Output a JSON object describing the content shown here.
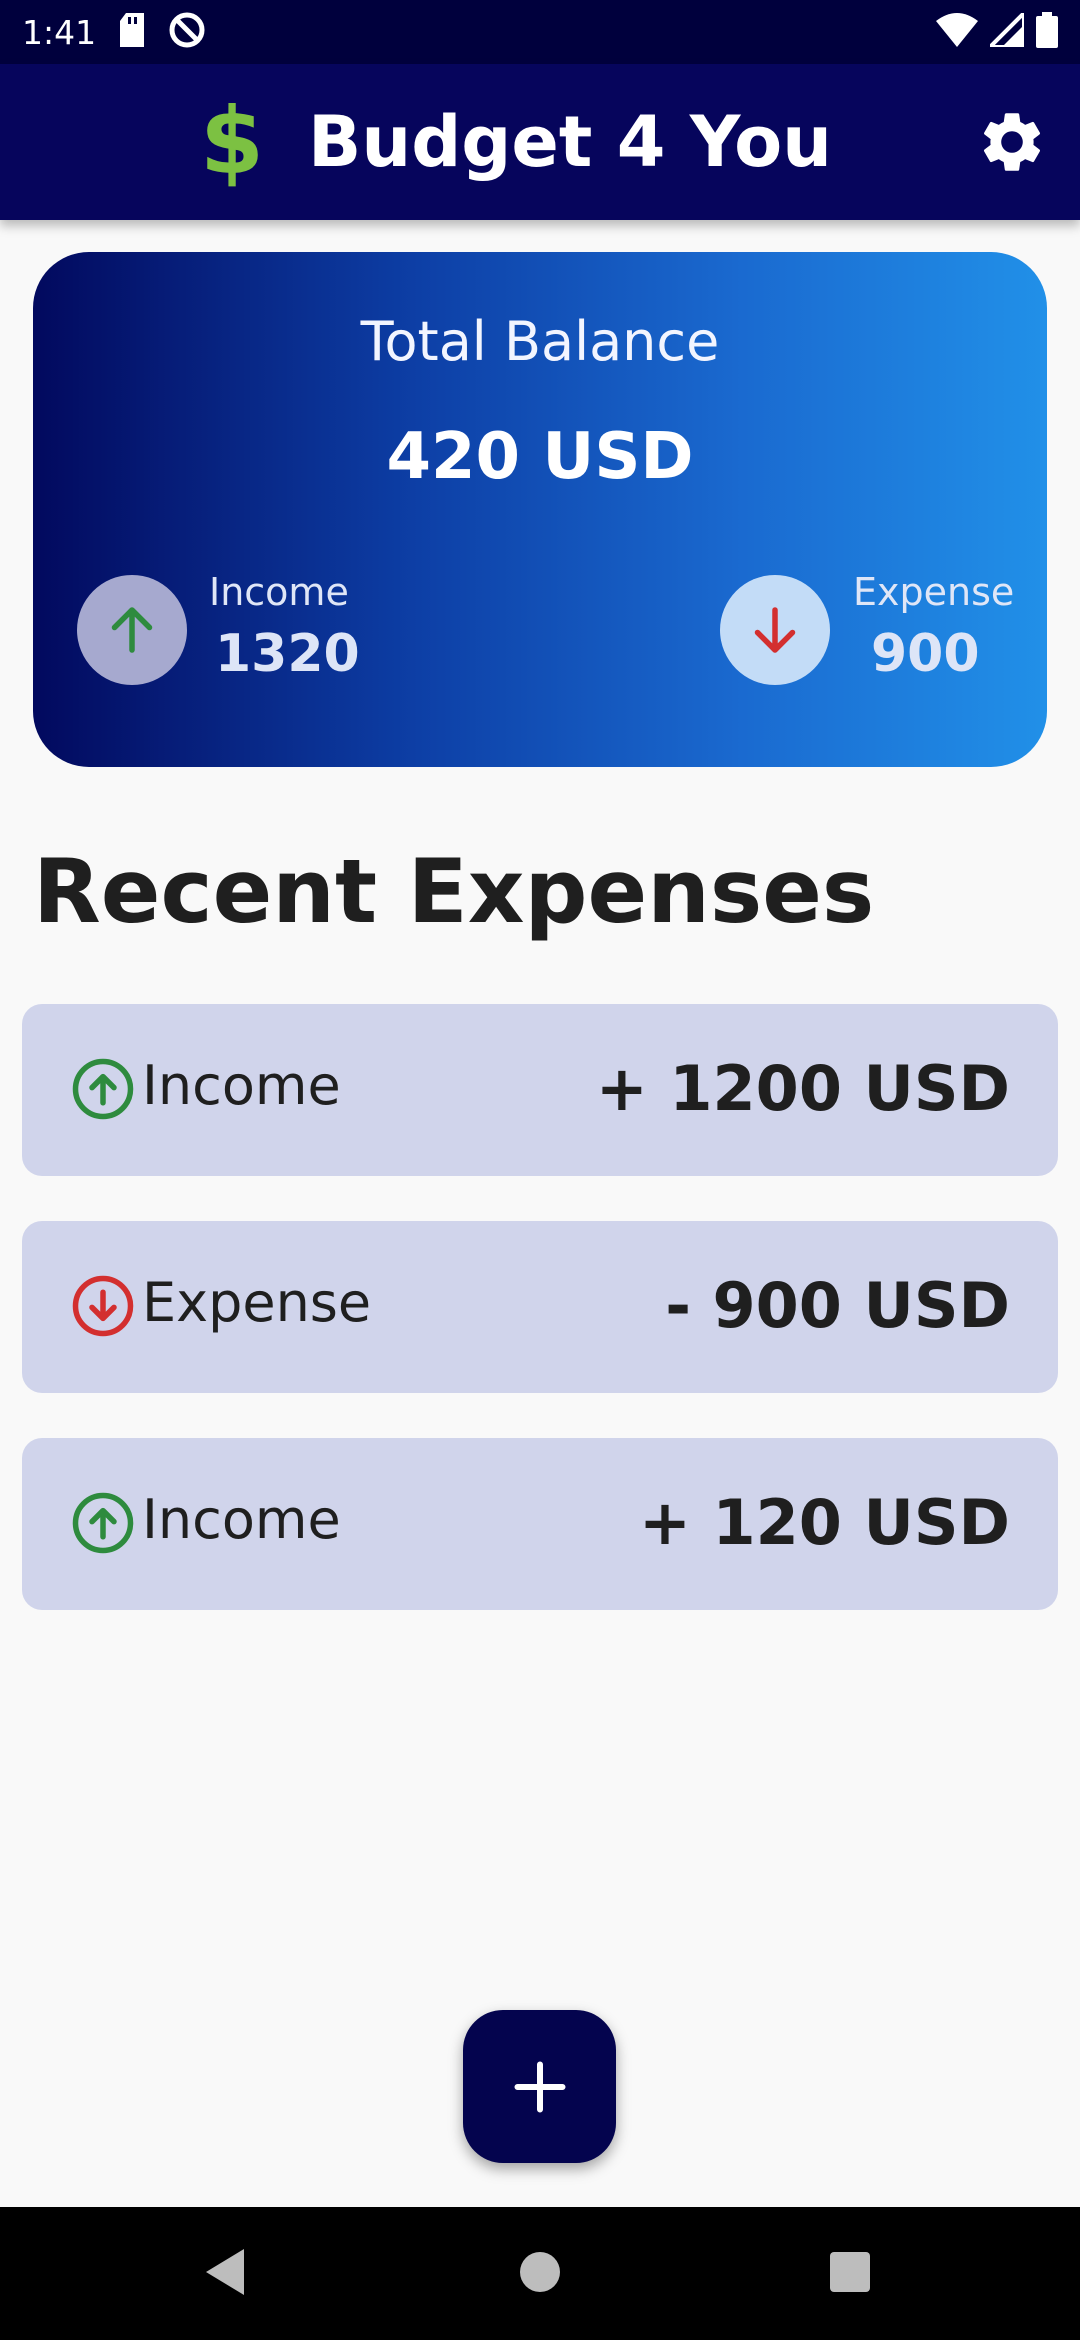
{
  "status_bar": {
    "time": "1:41",
    "icons": [
      "sd-card-icon",
      "do-not-disturb-icon",
      "wifi-icon",
      "signal-icon",
      "battery-icon"
    ]
  },
  "app_bar": {
    "logo_symbol": "$",
    "title": "Budget 4 You",
    "settings_icon": "gear-icon"
  },
  "balance_card": {
    "label": "Total Balance",
    "value": "420 USD",
    "income": {
      "label": "Income",
      "value": "1320",
      "icon": "arrow-up-icon"
    },
    "expense": {
      "label": "Expense",
      "value": "900",
      "icon": "arrow-down-icon"
    }
  },
  "recent": {
    "title": "Recent Expenses",
    "items": [
      {
        "label": "Income",
        "amount": "+ 1200 USD",
        "icon": "arrow-up-circle-icon"
      },
      {
        "label": "Expense",
        "amount": "- 900 USD",
        "icon": "arrow-down-circle-icon"
      },
      {
        "label": "Income",
        "amount": "+ 120 USD",
        "icon": "arrow-up-circle-icon"
      }
    ]
  },
  "fab": {
    "symbol": "+"
  },
  "colors": {
    "primary": "#06055c",
    "income_green": "#2e8b3e",
    "expense_red": "#d32f2f",
    "logo_green": "#7cc142",
    "row_bg": "#d0d4eb"
  },
  "nav": [
    "back-icon",
    "home-icon",
    "recents-icon"
  ]
}
